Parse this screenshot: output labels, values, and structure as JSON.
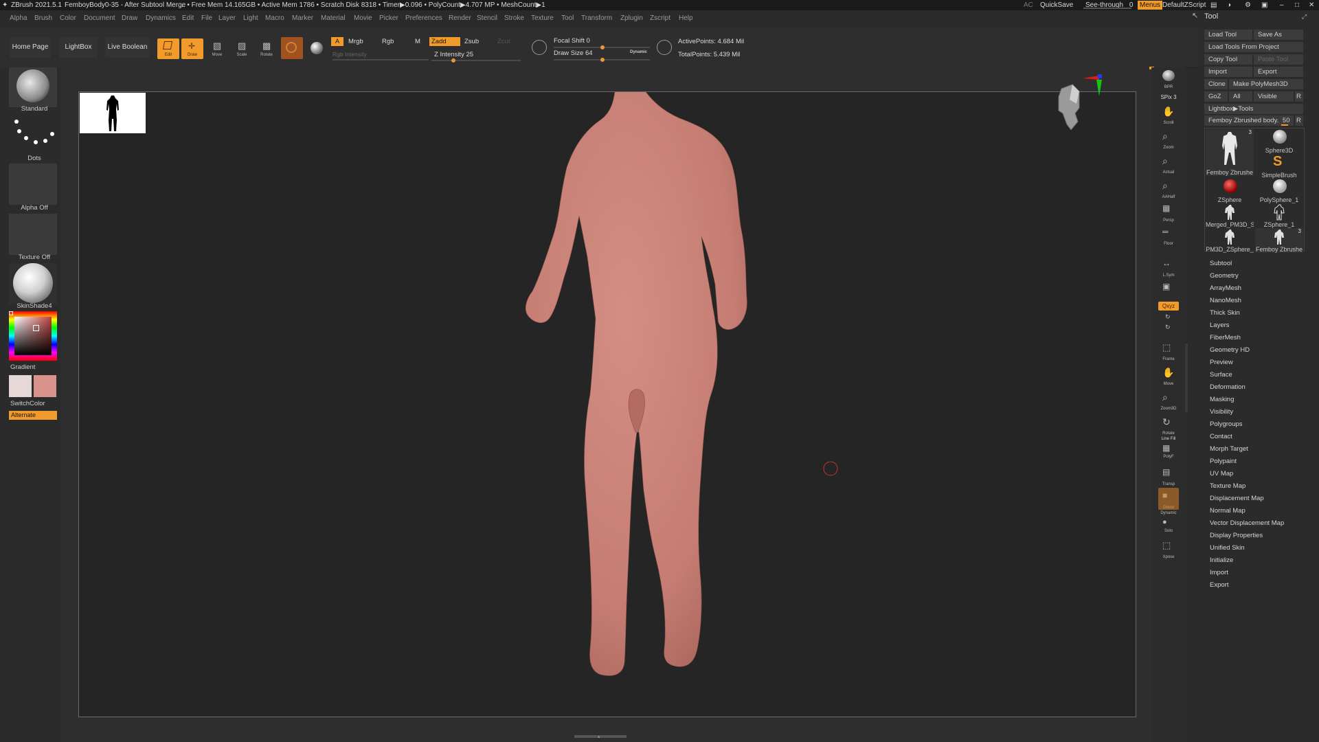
{
  "title_bar": {
    "app": "ZBrush 2021.5.1",
    "doc": "FemboyBody0-35 - After Subtool Merge",
    "stats": ".. • Free Mem 14.165GB • Active Mem 1786 • Scratch Disk 8318 • Timer▶0.096 • PolyCount▶4.707 MP • MeshCount▶1",
    "ac": "AC",
    "quicksave": "QuickSave",
    "see_through": "See-through",
    "see_through_value": "0",
    "menus": "Menus",
    "default_zscript": "DefaultZScript"
  },
  "menu_bar": [
    "Alpha",
    "Brush",
    "Color",
    "Document",
    "Draw",
    "Dynamics",
    "Edit",
    "File",
    "Layer",
    "Light",
    "Macro",
    "Marker",
    "Material",
    "Movie",
    "Picker",
    "Preferences",
    "Render",
    "Stencil",
    "Stroke",
    "Texture",
    "Tool",
    "Transform",
    "Zplugin",
    "Zscript",
    "Help"
  ],
  "shelf": {
    "home_page": "Home Page",
    "lightbox": "LightBox",
    "live_boolean": "Live Boolean",
    "edit": "Edit",
    "draw": "Draw",
    "move": "Move",
    "scale": "Scale",
    "rotate": "Rotate",
    "a": "A",
    "mrgb": "Mrgb",
    "rgb": "Rgb",
    "m": "M",
    "rgb_intensity": "Rgb Intensity",
    "zadd": "Zadd",
    "zsub": "Zsub",
    "zcut": "Zcut",
    "z_intensity_label": "Z Intensity",
    "z_intensity": "25",
    "z_intensity_frac": 0.25,
    "focal_shift_label": "Focal Shift",
    "focal_shift": "0",
    "draw_size_label": "Draw Size",
    "draw_size": "64",
    "dynamic": "Dynamic",
    "active_points": "ActivePoints: 4.684 Mil",
    "total_points": "TotalPoints: 5.439 Mil"
  },
  "left_panel": {
    "brush": "Standard",
    "stroke": "Dots",
    "alpha": "Alpha Off",
    "texture": "Texture Off",
    "material": "SkinShade4",
    "gradient": "Gradient",
    "switch_color": "SwitchColor",
    "alternate": "Alternate"
  },
  "right_shelf": [
    "BPR",
    "SPix 3",
    "Scroll",
    "Zoom",
    "Actual",
    "AAHalf",
    "Persp",
    "Floor",
    "L.Sym",
    "Lock",
    "Qxyz",
    "Frame",
    "Move",
    "Zoom3D",
    "Rotate",
    "Line Fill",
    "PolyF",
    "Transp",
    "Ghost",
    "Dynamic",
    "Solo",
    "Xpose"
  ],
  "tool_panel": {
    "title": "Tool",
    "buttons": {
      "load_tool": "Load Tool",
      "save_as": "Save As",
      "load_tools_from_project": "Load Tools From Project",
      "copy_tool": "Copy Tool",
      "paste_tool": "Paste Tool",
      "import": "Import",
      "export": "Export",
      "clone": "Clone",
      "make_polymesh": "Make PolyMesh3D",
      "goz": "GoZ",
      "all": "All",
      "visible": "Visible",
      "r": "R",
      "lightbox_tools": "Lightbox▶Tools",
      "current_tool": "Femboy Zbrushed body.",
      "current_tool_value": "50",
      "r2": "R"
    },
    "tools": [
      {
        "name": "Femboy Zbrushe",
        "badge": "3"
      },
      {
        "name": "Sphere3D",
        "badge": ""
      },
      {
        "name": "SimpleBrush",
        "badge": ""
      },
      {
        "name": "ZSphere",
        "badge": ""
      },
      {
        "name": "PolySphere_1",
        "badge": ""
      },
      {
        "name": "Merged_PM3D_S",
        "badge": ""
      },
      {
        "name": "ZSphere_1",
        "badge": ""
      },
      {
        "name": "PM3D_ZSphere_",
        "badge": ""
      },
      {
        "name": "Femboy Zbrushe",
        "badge": "3"
      }
    ],
    "sections": [
      "Subtool",
      "Geometry",
      "ArrayMesh",
      "NanoMesh",
      "Thick Skin",
      "Layers",
      "FiberMesh",
      "Geometry HD",
      "Preview",
      "Surface",
      "Deformation",
      "Masking",
      "Visibility",
      "Polygroups",
      "Contact",
      "Morph Target",
      "Polypaint",
      "UV Map",
      "Texture Map",
      "Displacement Map",
      "Normal Map",
      "Vector Displacement Map",
      "Display Properties",
      "Unified Skin",
      "Initialize",
      "Import",
      "Export"
    ]
  },
  "colors": {
    "accent": "#f19b2c",
    "skin": "#c9837a",
    "canvas": "#252525"
  }
}
